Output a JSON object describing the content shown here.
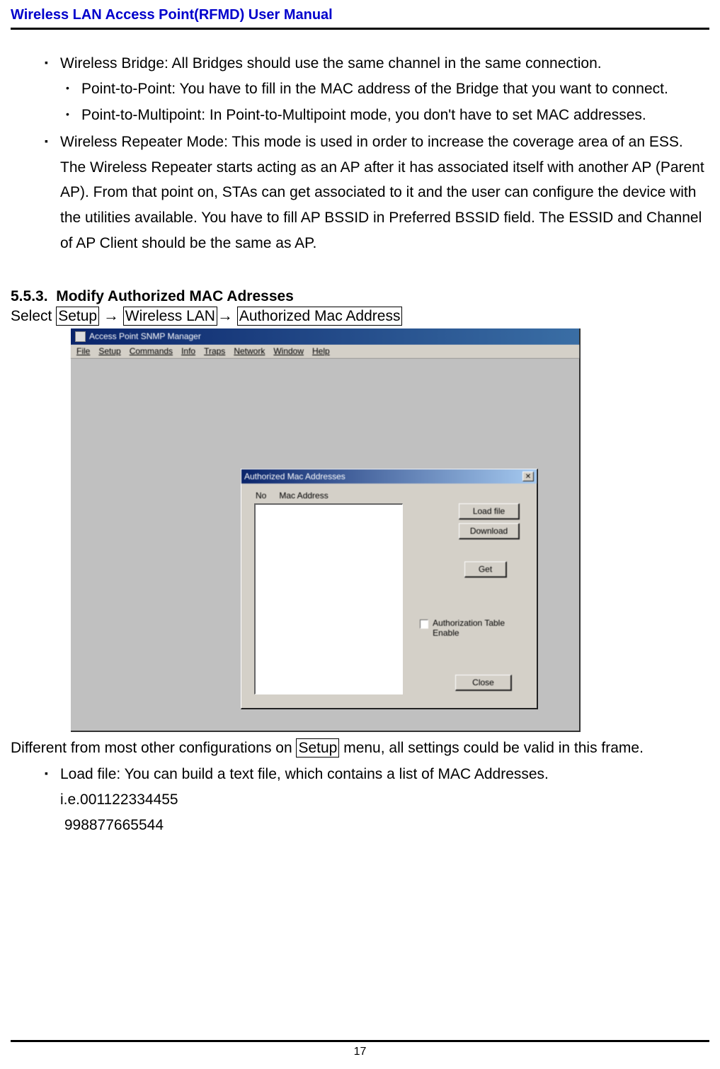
{
  "header_title": "Wireless LAN Access Point(RFMD) User Manual",
  "bullets": {
    "b1": "Wireless Bridge: All Bridges should use the same channel in the same connection.",
    "b1a": "Point-to-Point: You have to fill in the MAC address of the Bridge that you want to connect.",
    "b1b": "Point-to-Multipoint: In Point-to-Multipoint mode, you don't have to set MAC addresses.",
    "b2": "Wireless Repeater Mode: This mode is used in order to increase the coverage area of an ESS. The Wireless Repeater starts acting as an AP after it has associated itself with another AP (Parent AP). From that point on, STAs can get associated to it and the user can configure the device with the utilities available. You have to fill AP BSSID in Preferred BSSID field. The ESSID and Channel of AP Client should be the same as AP."
  },
  "section_num": "5.5.3.",
  "section_title": "Modify Authorized MAC Adresses",
  "select_prefix": "Select ",
  "nav": {
    "setup": "Setup",
    "wlan": "Wireless LAN",
    "ama": "Authorized Mac Address"
  },
  "screenshot": {
    "app_title": "Access Point SNMP Manager",
    "menu": {
      "file": "File",
      "setup": "Setup",
      "commands": "Commands",
      "info": "Info",
      "traps": "Traps",
      "network": "Network",
      "window": "Window",
      "help": "Help"
    },
    "dialog_title": "Authorized Mac Addresses",
    "col_no": "No",
    "col_mac": "Mac Address",
    "btn_loadfile": "Load file",
    "btn_download": "Download",
    "btn_get": "Get",
    "chk_label": "Authorization Table Enable",
    "btn_close": "Close"
  },
  "after_p1a": "Different from most other configurations on ",
  "after_p1_boxed": "Setup",
  "after_p1b": " menu, all settings could be valid in this frame.",
  "bullet_load": "Load file: You can build a text file, which contains a list of MAC Addresses.",
  "ie_label": "i.e.",
  "mac1": "001122334455",
  "mac2": "998877665544",
  "page_num": "17"
}
